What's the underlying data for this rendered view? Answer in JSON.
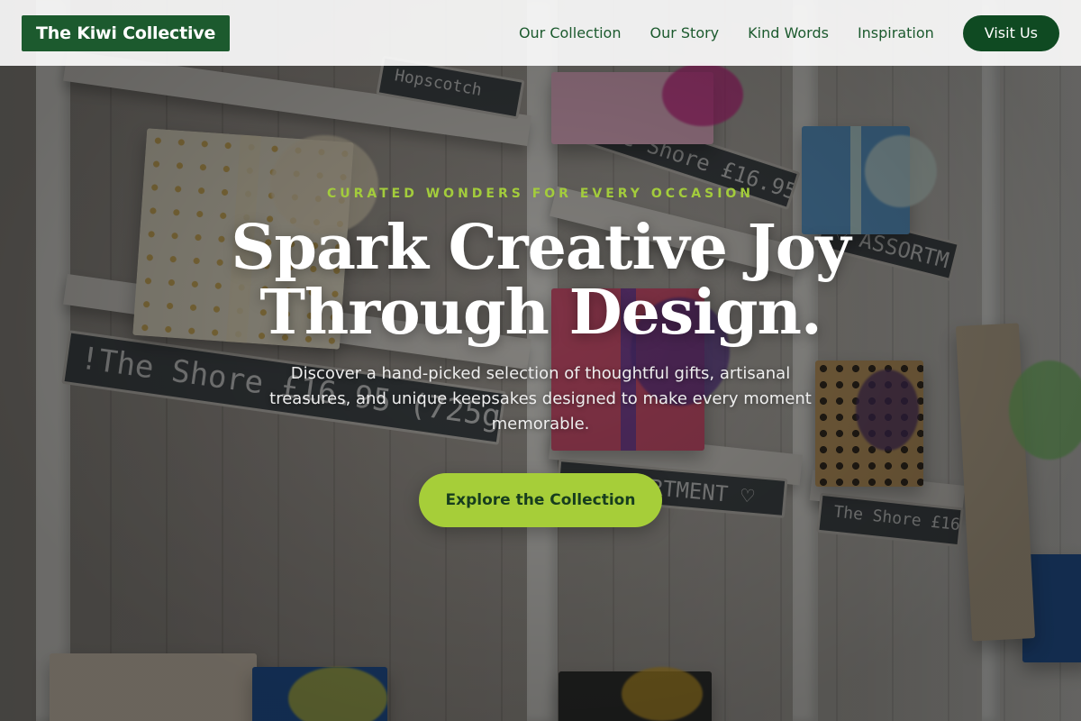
{
  "header": {
    "logo_text": "The Kiwi Collective",
    "nav": [
      {
        "label": "Our Collection"
      },
      {
        "label": "Our Story"
      },
      {
        "label": "Kind Words"
      },
      {
        "label": "Inspiration"
      }
    ],
    "cta_label": "Visit Us"
  },
  "hero": {
    "eyebrow": "CURATED WONDERS FOR EVERY OCCASION",
    "headline_line1": "Spark Creative Joy",
    "headline_line2": "Through Design.",
    "subtitle": "Discover a hand-picked selection of thoughtful gifts, artisanal treasures, and unique keepsakes designed to make every moment memorable.",
    "cta_label": "Explore the Collection",
    "background": {
      "description_labels": [
        "The Shore £16.95 (725g)",
        "ASSORTMENT",
        "The Shore £16.95 (725g)",
        "The Shore £16.95 (725g)"
      ]
    }
  },
  "colors": {
    "brand_green": "#1c5a2e",
    "cta_dark_green": "#0f4a22",
    "accent_lime": "#a6ce39",
    "eyebrow_lime": "#a3cc3c"
  }
}
